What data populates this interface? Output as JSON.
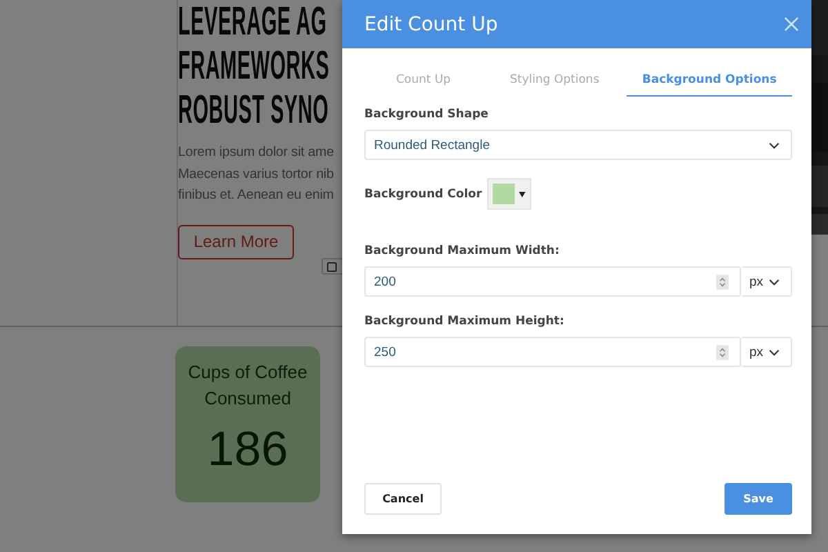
{
  "background_page": {
    "heading_lines": [
      "LEVERAGE AG",
      "FRAMEWORKS",
      "ROBUST SYNO"
    ],
    "paragraph_lines": [
      "Lorem ipsum dolor sit ame",
      "Maecenas varius tortor nib",
      "finibus et. Aenean eu enim"
    ],
    "button": "Learn More",
    "counter": {
      "title": "Cups of Coffee Consumed",
      "value": "186"
    }
  },
  "dialog": {
    "title": "Edit Count Up",
    "tabs": [
      {
        "label": "Count Up",
        "selected": false
      },
      {
        "label": "Styling Options",
        "selected": false
      },
      {
        "label": "Background Options",
        "selected": true
      }
    ],
    "fields": [
      {
        "kind": "select",
        "label": "Background Shape",
        "value": "Rounded Rectangle"
      },
      {
        "kind": "color",
        "label": "Background Color",
        "color": "#b3d9a3"
      },
      {
        "kind": "number",
        "label": "Background Maximum Width:",
        "value": "200",
        "unit": "px"
      },
      {
        "kind": "number",
        "label": "Background Maximum Height:",
        "value": "250",
        "unit": "px"
      }
    ],
    "buttons": [
      {
        "label": "Cancel",
        "kind": "secondary"
      },
      {
        "label": "Save",
        "kind": "primary"
      }
    ]
  }
}
